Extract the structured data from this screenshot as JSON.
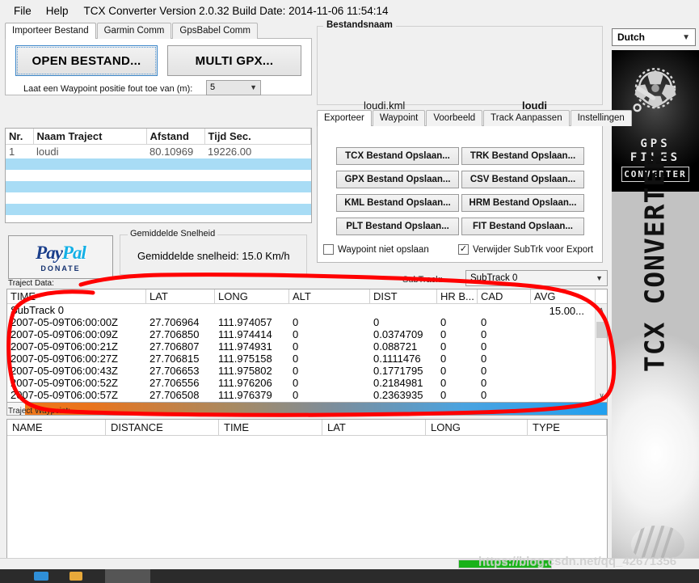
{
  "menu": {
    "items": [
      "File",
      "Help"
    ],
    "version_title": "TCX Converter Version 2.0.32 Build Date: 2014-11-06 11:54:14"
  },
  "left_panel": {
    "tabs": [
      {
        "label": "Importeer Bestand",
        "active": true
      },
      {
        "label": "Garmin Comm",
        "active": false
      },
      {
        "label": "GpsBabel Comm",
        "active": false
      }
    ],
    "open_button": "OPEN BESTAND...",
    "multi_button": "MULTI GPX...",
    "waypoint_error_label": "Laat een Waypoint positie fout toe van (m):",
    "waypoint_error_value": "5",
    "track_table": {
      "headers": [
        "Nr.",
        "Naam Traject",
        "Afstand",
        "Tijd Sec."
      ],
      "rows": [
        [
          "1",
          "loudi",
          "80.10969",
          "19226.00"
        ]
      ],
      "empty_row_count": 5
    },
    "paypal": {
      "brand_pay": "Pay",
      "brand_pal": "Pal",
      "donate": "DONATE"
    },
    "speed_group_legend": "Gemiddelde Snelheid",
    "speed_text": "Gemiddelde snelheid: 15.0 Km/h"
  },
  "right_panel": {
    "filename_legend": "Bestandsnaam",
    "filename": "loudi.kml",
    "trackname": "loudi",
    "tabs": [
      {
        "label": "Exporteer",
        "active": true
      },
      {
        "label": "Waypoint",
        "active": false
      },
      {
        "label": "Voorbeeld",
        "active": false
      },
      {
        "label": "Track Aanpassen",
        "active": false
      },
      {
        "label": "Instellingen",
        "active": false
      }
    ],
    "export_buttons": [
      "TCX Bestand Opslaan...",
      "TRK Bestand Opslaan...",
      "GPX Bestand Opslaan...",
      "CSV Bestand Opslaan...",
      "KML Bestand Opslaan...",
      "HRM Bestand Opslaan...",
      "PLT Bestand Opslaan...",
      "FIT Bestand Opslaan..."
    ],
    "checkbox_no_waypoint": {
      "label": "Waypoint niet opslaan",
      "checked": false,
      "mark": ""
    },
    "checkbox_remove_subtrk": {
      "label": "Verwijder SubTrk voor Export",
      "checked": true,
      "mark": "✓"
    }
  },
  "subtrack": {
    "label": "SubTrack:",
    "value": "SubTrack 0"
  },
  "traject_data": {
    "caption": "Traject Data:",
    "headers": [
      "TIME",
      "LAT",
      "LONG",
      "ALT",
      "DIST",
      "HR B...",
      "CAD",
      "AVG"
    ],
    "avg_first": "15.00...",
    "subtrack_row": "SubTrack 0",
    "rows": [
      [
        "2007-05-09T06:00:00Z",
        "27.706964",
        "111.974057",
        "0",
        "0",
        "0",
        "0",
        ""
      ],
      [
        "2007-05-09T06:00:09Z",
        "27.706850",
        "111.974414",
        "0",
        "0.0374709",
        "0",
        "0",
        ""
      ],
      [
        "2007-05-09T06:00:21Z",
        "27.706807",
        "111.974931",
        "0",
        "0.088721",
        "0",
        "0",
        ""
      ],
      [
        "2007-05-09T06:00:27Z",
        "27.706815",
        "111.975158",
        "0",
        "0.1111476",
        "0",
        "0",
        ""
      ],
      [
        "2007-05-09T06:00:43Z",
        "27.706653",
        "111.975802",
        "0",
        "0.1771795",
        "0",
        "0",
        ""
      ],
      [
        "2007-05-09T06:00:52Z",
        "27.706556",
        "111.976206",
        "0",
        "0.2184981",
        "0",
        "0",
        ""
      ],
      [
        "2007-05-09T06:00:57Z",
        "27.706508",
        "111.976379",
        "0",
        "0.2363935",
        "0",
        "0",
        ""
      ]
    ],
    "scroll_up_glyph": "∧",
    "scroll_down_glyph": "∨"
  },
  "waypoint_data": {
    "caption": "Traject Waypoint:",
    "headers": [
      "NAME",
      "DISTANCE",
      "TIME",
      "LAT",
      "LONG",
      "TYPE"
    ],
    "rows": []
  },
  "branding": {
    "language": "Dutch",
    "logo_line1": "GPS",
    "logo_line2": "FILES",
    "logo_badge": "CONVERTER",
    "vertical_title": "TCX CONVERTER"
  },
  "statusbar": {
    "progress_percent": 100,
    "watermark": "https://blog.csdn.net/qq_42671356"
  },
  "colors": {
    "accent_blue": "#21a0ef",
    "accent_orange": "#f07818",
    "progress_green": "#19b219",
    "row_highlight": "#a8dcf5",
    "annotation_red": "#ff0000"
  }
}
